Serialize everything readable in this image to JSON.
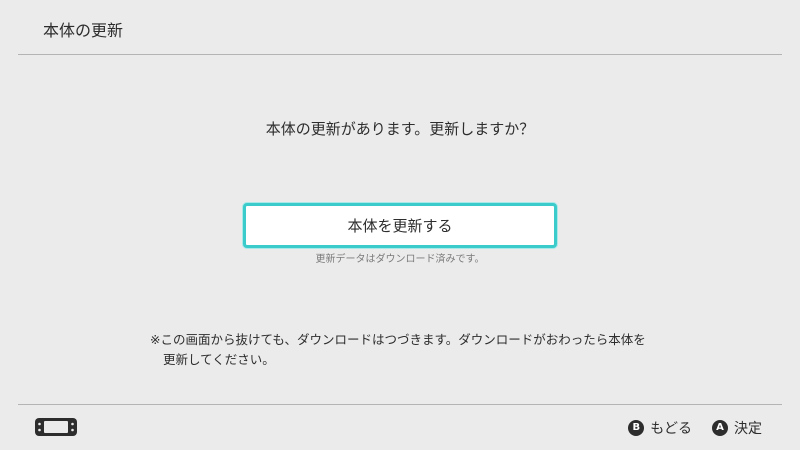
{
  "header": {
    "title": "本体の更新"
  },
  "main": {
    "question": "本体の更新があります。更新しますか？",
    "update_button_label": "本体を更新する",
    "download_status": "更新データはダウンロード済みです。",
    "note_line1": "※この画面から抜けても、ダウンロードはつづきます。ダウンロードがおわったら本体を",
    "note_line2": "更新してください。"
  },
  "footer": {
    "console_icon": "handheld-console-icon",
    "actions": [
      {
        "glyph": "B",
        "label": "もどる",
        "icon": "b-button-icon"
      },
      {
        "glyph": "A",
        "label": "決定",
        "icon": "a-button-icon"
      }
    ]
  },
  "colors": {
    "background": "#ebebeb",
    "text": "#2d2d2d",
    "accent_border": "#3ccbcb",
    "divider": "#b4b4b4",
    "muted_text": "#7a7a7a"
  }
}
